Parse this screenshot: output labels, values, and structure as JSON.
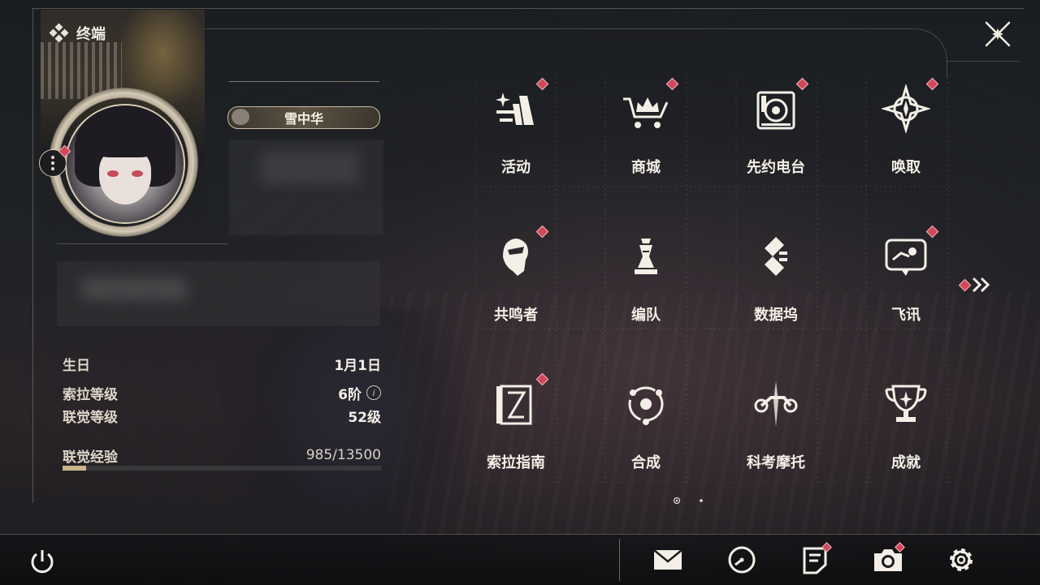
{
  "header": {
    "title": "终端"
  },
  "profile": {
    "player_name": "雪中华"
  },
  "stats": {
    "birthday_label": "生日",
    "birthday_value": "1月1日",
    "sola_level_label": "索拉等级",
    "sola_level_value": "6阶",
    "union_level_label": "联觉等级",
    "union_level_value": "52级",
    "exp_label": "联觉经验",
    "exp_value": "985/13500",
    "exp_progress": 0.073
  },
  "menu": {
    "items": [
      {
        "label": "活动",
        "icon": "sparkle-activity-icon",
        "notify": true
      },
      {
        "label": "商城",
        "icon": "crown-cart-icon",
        "notify": true
      },
      {
        "label": "先约电台",
        "icon": "radio-speaker-icon",
        "notify": true
      },
      {
        "label": "唤取",
        "icon": "compass-star-icon",
        "notify": true
      },
      {
        "label": "共鸣者",
        "icon": "character-head-icon",
        "notify": true
      },
      {
        "label": "编队",
        "icon": "chess-team-icon",
        "notify": false
      },
      {
        "label": "数据坞",
        "icon": "data-dock-icon",
        "notify": false
      },
      {
        "label": "飞讯",
        "icon": "chat-bubble-icon",
        "notify": true
      },
      {
        "label": "索拉指南",
        "icon": "guide-book-icon",
        "notify": true
      },
      {
        "label": "合成",
        "icon": "synthesis-orb-icon",
        "notify": false
      },
      {
        "label": "科考摩托",
        "icon": "motorcycle-icon",
        "notify": false
      },
      {
        "label": "成就",
        "icon": "trophy-icon",
        "notify": false
      }
    ],
    "current_page": 1,
    "total_pages": 2
  },
  "bottom_bar": {
    "icons": [
      "power-icon",
      "mail-icon",
      "clock-icon",
      "notice-icon",
      "camera-icon",
      "settings-icon"
    ],
    "notify": {
      "notice-icon": true,
      "camera-icon": true
    }
  },
  "colors": {
    "accent_gold": "#c9b487",
    "notify_red": "#d0485a",
    "text": "#f3efe6"
  }
}
